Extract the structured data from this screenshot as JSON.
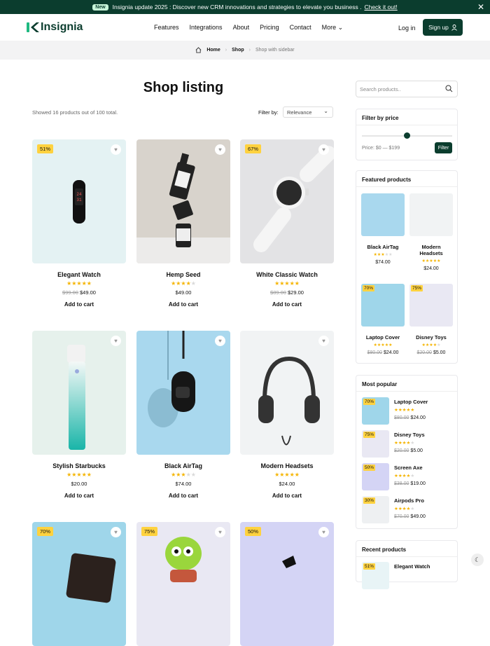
{
  "announcement": {
    "badge": "New",
    "text": "Insignia update 2025 : Discover new CRM innovations and strategies to elevate you business .",
    "link": "Check it out!",
    "close": "✕"
  },
  "nav": {
    "brand": "Insignia",
    "items": [
      "Features",
      "Integrations",
      "About",
      "Pricing",
      "Contact",
      "More"
    ],
    "login": "Log in",
    "signup": "Sign up"
  },
  "breadcrumb": {
    "home": "Home",
    "shop": "Shop",
    "current": "Shop with sidebar"
  },
  "page": {
    "title": "Shop listing",
    "showed": "Showed 16 products out of 100 total.",
    "filter_label": "Filter by:",
    "filter_value": "Relevance"
  },
  "products": [
    {
      "name": "Elegant Watch",
      "badge": "51%",
      "rating": 5,
      "old_price": "$99.00",
      "price": "$49.00",
      "cart": "Add to cart"
    },
    {
      "name": "Hemp Seed",
      "badge": "",
      "rating": 4,
      "old_price": "",
      "price": "$49.00",
      "cart": "Add to cart"
    },
    {
      "name": "White Classic Watch",
      "badge": "67%",
      "rating": 5,
      "old_price": "$89.00",
      "price": "$29.00",
      "cart": "Add to cart"
    },
    {
      "name": "Stylish Starbucks",
      "badge": "",
      "rating": 5,
      "old_price": "",
      "price": "$20.00",
      "cart": "Add to cart"
    },
    {
      "name": "Black AirTag",
      "badge": "",
      "rating": 3,
      "old_price": "",
      "price": "$74.00",
      "cart": "Add to cart"
    },
    {
      "name": "Modern Headsets",
      "badge": "",
      "rating": 5,
      "old_price": "",
      "price": "$24.00",
      "cart": "Add to cart"
    },
    {
      "name": "",
      "badge": "70%",
      "rating": 0,
      "old_price": "",
      "price": "",
      "cart": ""
    },
    {
      "name": "",
      "badge": "75%",
      "rating": 0,
      "old_price": "",
      "price": "",
      "cart": ""
    },
    {
      "name": "",
      "badge": "50%",
      "rating": 0,
      "old_price": "",
      "price": "",
      "cart": ""
    }
  ],
  "sidebar": {
    "search_placeholder": "Search products..",
    "price_filter": {
      "title": "Filter by price",
      "label": "Price: $0 — $199",
      "button": "Filter",
      "level": 0.5
    },
    "featured": {
      "title": "Featured products",
      "items": [
        {
          "name": "Black AirTag",
          "badge": "",
          "rating": 3,
          "old_price": "",
          "price": "$74.00"
        },
        {
          "name": "Modern Headsets",
          "badge": "",
          "rating": 5,
          "old_price": "",
          "price": "$24.00"
        },
        {
          "name": "Laptop Cover",
          "badge": "70%",
          "rating": 5,
          "old_price": "$80.00",
          "price": "$24.00"
        },
        {
          "name": "Disney Toys",
          "badge": "75%",
          "rating": 4,
          "old_price": "$20.00",
          "price": "$5.00"
        }
      ]
    },
    "popular": {
      "title": "Most popular",
      "items": [
        {
          "name": "Laptop Cover",
          "badge": "70%",
          "rating": 5,
          "old_price": "$80.00",
          "price": "$24.00"
        },
        {
          "name": "Disney Toys",
          "badge": "75%",
          "rating": 4,
          "old_price": "$20.00",
          "price": "$5.00"
        },
        {
          "name": "Screen Axe",
          "badge": "50%",
          "rating": 4,
          "old_price": "$38.00",
          "price": "$19.00"
        },
        {
          "name": "Airpods Pro",
          "badge": "30%",
          "rating": 4,
          "old_price": "$70.00",
          "price": "$49.00"
        }
      ]
    },
    "recent": {
      "title": "Recent products",
      "items": [
        {
          "name": "Elegant Watch",
          "badge": "51%"
        }
      ]
    }
  },
  "colors": {
    "brand": "#0b3d2e",
    "badge": "#ffd23f",
    "star": "#f5b400"
  }
}
